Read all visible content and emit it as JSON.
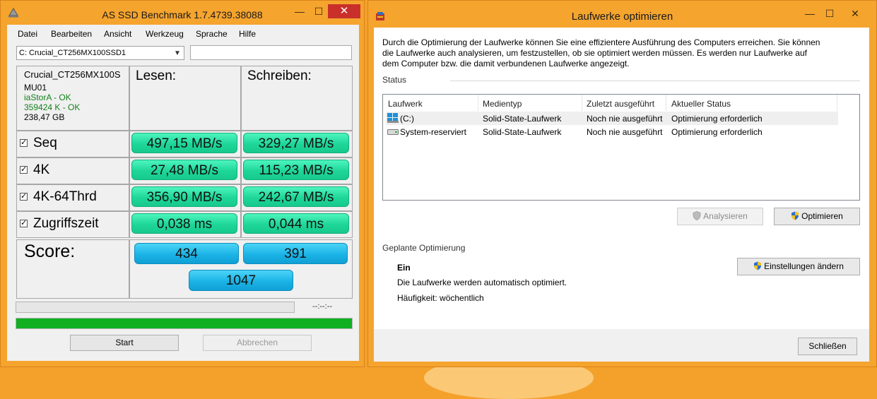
{
  "asssd": {
    "title": "AS SSD Benchmark 1.7.4739.38088",
    "caption": {
      "minimize": "—",
      "maximize": "☐",
      "close": "✕"
    },
    "menu": [
      "Datei",
      "Bearbeiten",
      "Ansicht",
      "Werkzeug",
      "Sprache",
      "Hilfe"
    ],
    "drive_select": "C: Crucial_CT256MX100SSD1",
    "info": {
      "model": "Crucial_CT256MX100S",
      "firmware": "MU01",
      "driver": "iaStorA - OK",
      "alignment": "359424 K - OK",
      "size": "238,47 GB"
    },
    "headers": {
      "read": "Lesen:",
      "write": "Schreiben:"
    },
    "rows": [
      {
        "label": "Seq",
        "read": "497,15 MB/s",
        "write": "329,27 MB/s"
      },
      {
        "label": "4K",
        "read": "27,48 MB/s",
        "write": "115,23 MB/s"
      },
      {
        "label": "4K-64Thrd",
        "read": "356,90 MB/s",
        "write": "242,67 MB/s"
      },
      {
        "label": "Zugriffszeit",
        "read": "0,038 ms",
        "write": "0,044 ms"
      }
    ],
    "score": {
      "label": "Score:",
      "read": "434",
      "write": "391",
      "total": "1047"
    },
    "time_display": "--:--:--",
    "progress_fraction": 1.0,
    "buttons": {
      "start": "Start",
      "cancel": "Abbrechen"
    },
    "colors": {
      "value_green": "#1fd699",
      "score_blue": "#1bb3e6",
      "progress_green": "#10b021"
    }
  },
  "optimize": {
    "title": "Laufwerke optimieren",
    "caption": {
      "minimize": "—",
      "maximize": "☐",
      "close": "✕"
    },
    "description": "Durch die Optimierung der Laufwerke können Sie eine effizientere Ausführung des Computers erreichen. Sie können die Laufwerke auch analysieren, um festzustellen, ob sie optimiert werden müssen. Es werden nur Laufwerke auf dem Computer bzw. die damit verbundenen Laufwerke angezeigt.",
    "status_label": "Status",
    "columns": [
      "Laufwerk",
      "Medientyp",
      "Zuletzt ausgeführt",
      "Aktueller Status"
    ],
    "drives": [
      {
        "name": "(C:)",
        "icon": "windows-drive-icon",
        "media": "Solid-State-Laufwerk",
        "last_run": "Noch nie ausgeführt",
        "status": "Optimierung erforderlich"
      },
      {
        "name": "System-reserviert",
        "icon": "drive-icon",
        "media": "Solid-State-Laufwerk",
        "last_run": "Noch nie ausgeführt",
        "status": "Optimierung erforderlich"
      }
    ],
    "buttons": {
      "analyze": "Analysieren",
      "optimize": "Optimieren",
      "change_settings": "Einstellungen ändern",
      "close": "Schließen"
    },
    "scheduled": {
      "label": "Geplante Optimierung",
      "state": "Ein",
      "info": "Die Laufwerke werden automatisch optimiert.",
      "frequency": "Häufigkeit: wöchentlich"
    }
  },
  "desktop_color": "#f4a12c"
}
